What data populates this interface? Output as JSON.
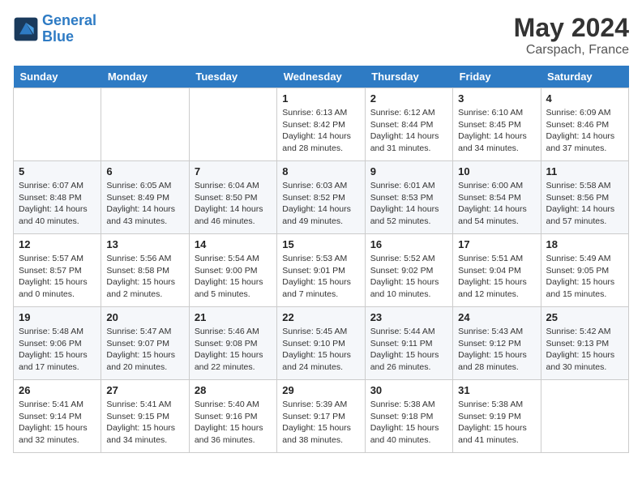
{
  "header": {
    "logo_general": "General",
    "logo_blue": "Blue",
    "month_title": "May 2024",
    "location": "Carspach, France"
  },
  "days_of_week": [
    "Sunday",
    "Monday",
    "Tuesday",
    "Wednesday",
    "Thursday",
    "Friday",
    "Saturday"
  ],
  "weeks": [
    [
      {
        "day": "",
        "info": ""
      },
      {
        "day": "",
        "info": ""
      },
      {
        "day": "",
        "info": ""
      },
      {
        "day": "1",
        "info": "Sunrise: 6:13 AM\nSunset: 8:42 PM\nDaylight: 14 hours\nand 28 minutes."
      },
      {
        "day": "2",
        "info": "Sunrise: 6:12 AM\nSunset: 8:44 PM\nDaylight: 14 hours\nand 31 minutes."
      },
      {
        "day": "3",
        "info": "Sunrise: 6:10 AM\nSunset: 8:45 PM\nDaylight: 14 hours\nand 34 minutes."
      },
      {
        "day": "4",
        "info": "Sunrise: 6:09 AM\nSunset: 8:46 PM\nDaylight: 14 hours\nand 37 minutes."
      }
    ],
    [
      {
        "day": "5",
        "info": "Sunrise: 6:07 AM\nSunset: 8:48 PM\nDaylight: 14 hours\nand 40 minutes."
      },
      {
        "day": "6",
        "info": "Sunrise: 6:05 AM\nSunset: 8:49 PM\nDaylight: 14 hours\nand 43 minutes."
      },
      {
        "day": "7",
        "info": "Sunrise: 6:04 AM\nSunset: 8:50 PM\nDaylight: 14 hours\nand 46 minutes."
      },
      {
        "day": "8",
        "info": "Sunrise: 6:03 AM\nSunset: 8:52 PM\nDaylight: 14 hours\nand 49 minutes."
      },
      {
        "day": "9",
        "info": "Sunrise: 6:01 AM\nSunset: 8:53 PM\nDaylight: 14 hours\nand 52 minutes."
      },
      {
        "day": "10",
        "info": "Sunrise: 6:00 AM\nSunset: 8:54 PM\nDaylight: 14 hours\nand 54 minutes."
      },
      {
        "day": "11",
        "info": "Sunrise: 5:58 AM\nSunset: 8:56 PM\nDaylight: 14 hours\nand 57 minutes."
      }
    ],
    [
      {
        "day": "12",
        "info": "Sunrise: 5:57 AM\nSunset: 8:57 PM\nDaylight: 15 hours\nand 0 minutes."
      },
      {
        "day": "13",
        "info": "Sunrise: 5:56 AM\nSunset: 8:58 PM\nDaylight: 15 hours\nand 2 minutes."
      },
      {
        "day": "14",
        "info": "Sunrise: 5:54 AM\nSunset: 9:00 PM\nDaylight: 15 hours\nand 5 minutes."
      },
      {
        "day": "15",
        "info": "Sunrise: 5:53 AM\nSunset: 9:01 PM\nDaylight: 15 hours\nand 7 minutes."
      },
      {
        "day": "16",
        "info": "Sunrise: 5:52 AM\nSunset: 9:02 PM\nDaylight: 15 hours\nand 10 minutes."
      },
      {
        "day": "17",
        "info": "Sunrise: 5:51 AM\nSunset: 9:04 PM\nDaylight: 15 hours\nand 12 minutes."
      },
      {
        "day": "18",
        "info": "Sunrise: 5:49 AM\nSunset: 9:05 PM\nDaylight: 15 hours\nand 15 minutes."
      }
    ],
    [
      {
        "day": "19",
        "info": "Sunrise: 5:48 AM\nSunset: 9:06 PM\nDaylight: 15 hours\nand 17 minutes."
      },
      {
        "day": "20",
        "info": "Sunrise: 5:47 AM\nSunset: 9:07 PM\nDaylight: 15 hours\nand 20 minutes."
      },
      {
        "day": "21",
        "info": "Sunrise: 5:46 AM\nSunset: 9:08 PM\nDaylight: 15 hours\nand 22 minutes."
      },
      {
        "day": "22",
        "info": "Sunrise: 5:45 AM\nSunset: 9:10 PM\nDaylight: 15 hours\nand 24 minutes."
      },
      {
        "day": "23",
        "info": "Sunrise: 5:44 AM\nSunset: 9:11 PM\nDaylight: 15 hours\nand 26 minutes."
      },
      {
        "day": "24",
        "info": "Sunrise: 5:43 AM\nSunset: 9:12 PM\nDaylight: 15 hours\nand 28 minutes."
      },
      {
        "day": "25",
        "info": "Sunrise: 5:42 AM\nSunset: 9:13 PM\nDaylight: 15 hours\nand 30 minutes."
      }
    ],
    [
      {
        "day": "26",
        "info": "Sunrise: 5:41 AM\nSunset: 9:14 PM\nDaylight: 15 hours\nand 32 minutes."
      },
      {
        "day": "27",
        "info": "Sunrise: 5:41 AM\nSunset: 9:15 PM\nDaylight: 15 hours\nand 34 minutes."
      },
      {
        "day": "28",
        "info": "Sunrise: 5:40 AM\nSunset: 9:16 PM\nDaylight: 15 hours\nand 36 minutes."
      },
      {
        "day": "29",
        "info": "Sunrise: 5:39 AM\nSunset: 9:17 PM\nDaylight: 15 hours\nand 38 minutes."
      },
      {
        "day": "30",
        "info": "Sunrise: 5:38 AM\nSunset: 9:18 PM\nDaylight: 15 hours\nand 40 minutes."
      },
      {
        "day": "31",
        "info": "Sunrise: 5:38 AM\nSunset: 9:19 PM\nDaylight: 15 hours\nand 41 minutes."
      },
      {
        "day": "",
        "info": ""
      }
    ]
  ]
}
